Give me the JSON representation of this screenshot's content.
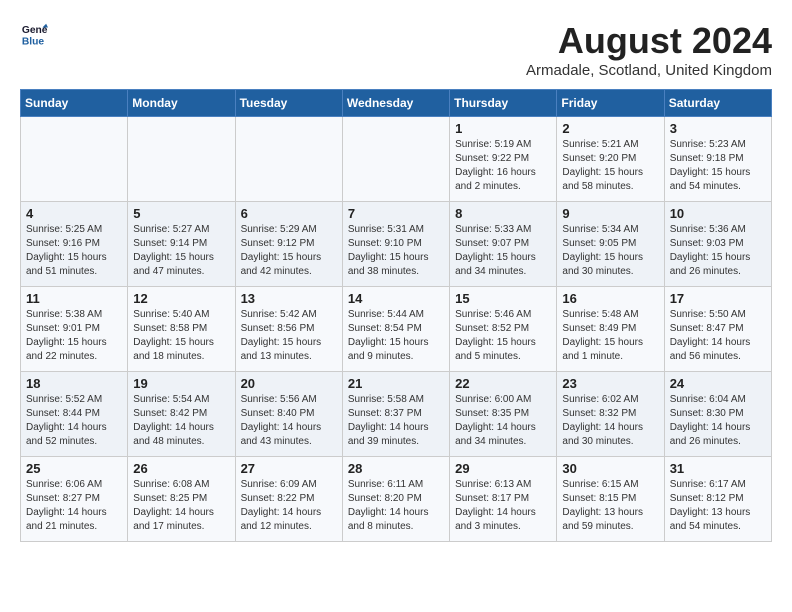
{
  "header": {
    "logo_line1": "General",
    "logo_line2": "Blue",
    "month_year": "August 2024",
    "location": "Armadale, Scotland, United Kingdom"
  },
  "weekdays": [
    "Sunday",
    "Monday",
    "Tuesday",
    "Wednesday",
    "Thursday",
    "Friday",
    "Saturday"
  ],
  "weeks": [
    [
      {
        "day": "",
        "content": ""
      },
      {
        "day": "",
        "content": ""
      },
      {
        "day": "",
        "content": ""
      },
      {
        "day": "",
        "content": ""
      },
      {
        "day": "1",
        "content": "Sunrise: 5:19 AM\nSunset: 9:22 PM\nDaylight: 16 hours\nand 2 minutes."
      },
      {
        "day": "2",
        "content": "Sunrise: 5:21 AM\nSunset: 9:20 PM\nDaylight: 15 hours\nand 58 minutes."
      },
      {
        "day": "3",
        "content": "Sunrise: 5:23 AM\nSunset: 9:18 PM\nDaylight: 15 hours\nand 54 minutes."
      }
    ],
    [
      {
        "day": "4",
        "content": "Sunrise: 5:25 AM\nSunset: 9:16 PM\nDaylight: 15 hours\nand 51 minutes."
      },
      {
        "day": "5",
        "content": "Sunrise: 5:27 AM\nSunset: 9:14 PM\nDaylight: 15 hours\nand 47 minutes."
      },
      {
        "day": "6",
        "content": "Sunrise: 5:29 AM\nSunset: 9:12 PM\nDaylight: 15 hours\nand 42 minutes."
      },
      {
        "day": "7",
        "content": "Sunrise: 5:31 AM\nSunset: 9:10 PM\nDaylight: 15 hours\nand 38 minutes."
      },
      {
        "day": "8",
        "content": "Sunrise: 5:33 AM\nSunset: 9:07 PM\nDaylight: 15 hours\nand 34 minutes."
      },
      {
        "day": "9",
        "content": "Sunrise: 5:34 AM\nSunset: 9:05 PM\nDaylight: 15 hours\nand 30 minutes."
      },
      {
        "day": "10",
        "content": "Sunrise: 5:36 AM\nSunset: 9:03 PM\nDaylight: 15 hours\nand 26 minutes."
      }
    ],
    [
      {
        "day": "11",
        "content": "Sunrise: 5:38 AM\nSunset: 9:01 PM\nDaylight: 15 hours\nand 22 minutes."
      },
      {
        "day": "12",
        "content": "Sunrise: 5:40 AM\nSunset: 8:58 PM\nDaylight: 15 hours\nand 18 minutes."
      },
      {
        "day": "13",
        "content": "Sunrise: 5:42 AM\nSunset: 8:56 PM\nDaylight: 15 hours\nand 13 minutes."
      },
      {
        "day": "14",
        "content": "Sunrise: 5:44 AM\nSunset: 8:54 PM\nDaylight: 15 hours\nand 9 minutes."
      },
      {
        "day": "15",
        "content": "Sunrise: 5:46 AM\nSunset: 8:52 PM\nDaylight: 15 hours\nand 5 minutes."
      },
      {
        "day": "16",
        "content": "Sunrise: 5:48 AM\nSunset: 8:49 PM\nDaylight: 15 hours\nand 1 minute."
      },
      {
        "day": "17",
        "content": "Sunrise: 5:50 AM\nSunset: 8:47 PM\nDaylight: 14 hours\nand 56 minutes."
      }
    ],
    [
      {
        "day": "18",
        "content": "Sunrise: 5:52 AM\nSunset: 8:44 PM\nDaylight: 14 hours\nand 52 minutes."
      },
      {
        "day": "19",
        "content": "Sunrise: 5:54 AM\nSunset: 8:42 PM\nDaylight: 14 hours\nand 48 minutes."
      },
      {
        "day": "20",
        "content": "Sunrise: 5:56 AM\nSunset: 8:40 PM\nDaylight: 14 hours\nand 43 minutes."
      },
      {
        "day": "21",
        "content": "Sunrise: 5:58 AM\nSunset: 8:37 PM\nDaylight: 14 hours\nand 39 minutes."
      },
      {
        "day": "22",
        "content": "Sunrise: 6:00 AM\nSunset: 8:35 PM\nDaylight: 14 hours\nand 34 minutes."
      },
      {
        "day": "23",
        "content": "Sunrise: 6:02 AM\nSunset: 8:32 PM\nDaylight: 14 hours\nand 30 minutes."
      },
      {
        "day": "24",
        "content": "Sunrise: 6:04 AM\nSunset: 8:30 PM\nDaylight: 14 hours\nand 26 minutes."
      }
    ],
    [
      {
        "day": "25",
        "content": "Sunrise: 6:06 AM\nSunset: 8:27 PM\nDaylight: 14 hours\nand 21 minutes."
      },
      {
        "day": "26",
        "content": "Sunrise: 6:08 AM\nSunset: 8:25 PM\nDaylight: 14 hours\nand 17 minutes."
      },
      {
        "day": "27",
        "content": "Sunrise: 6:09 AM\nSunset: 8:22 PM\nDaylight: 14 hours\nand 12 minutes."
      },
      {
        "day": "28",
        "content": "Sunrise: 6:11 AM\nSunset: 8:20 PM\nDaylight: 14 hours\nand 8 minutes."
      },
      {
        "day": "29",
        "content": "Sunrise: 6:13 AM\nSunset: 8:17 PM\nDaylight: 14 hours\nand 3 minutes."
      },
      {
        "day": "30",
        "content": "Sunrise: 6:15 AM\nSunset: 8:15 PM\nDaylight: 13 hours\nand 59 minutes."
      },
      {
        "day": "31",
        "content": "Sunrise: 6:17 AM\nSunset: 8:12 PM\nDaylight: 13 hours\nand 54 minutes."
      }
    ]
  ]
}
